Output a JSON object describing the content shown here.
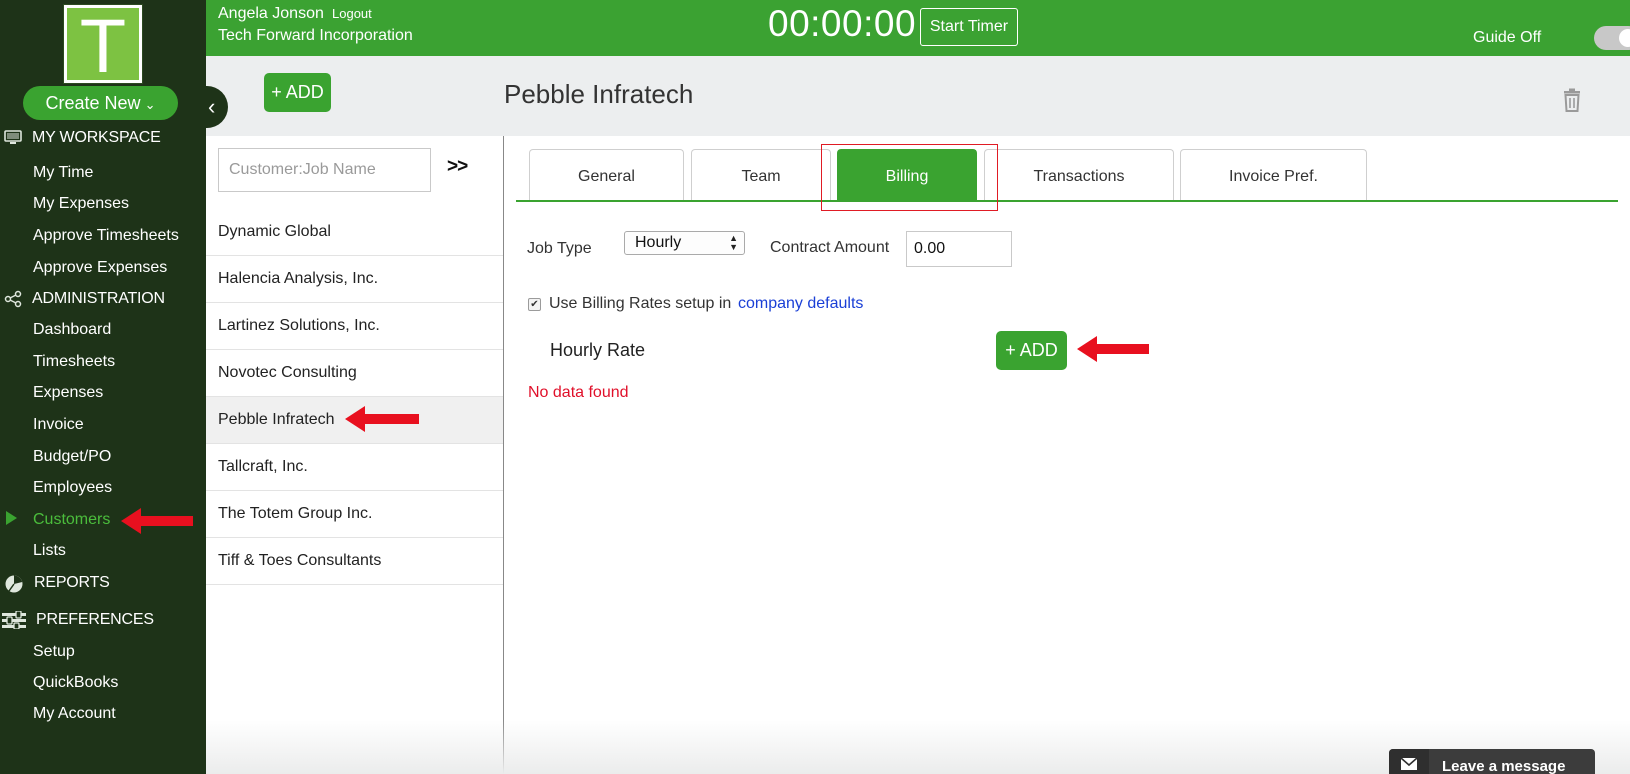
{
  "sidebar": {
    "logo_letter": "T",
    "create_new_label": "Create New",
    "create_new_chevron": "⌄",
    "sections": {
      "workspace": {
        "label": "MY WORKSPACE",
        "icon": "monitor-icon"
      },
      "administration": {
        "label": "ADMINISTRATION",
        "icon": "share-icon"
      },
      "reports": {
        "label": "REPORTS",
        "icon": "pie-chart-icon"
      },
      "preferences": {
        "label": "PREFERENCES",
        "icon": "sliders-icon"
      }
    },
    "workspace_items": [
      "My Time",
      "My Expenses",
      "Approve Timesheets",
      "Approve Expenses"
    ],
    "admin_items": [
      "Dashboard",
      "Timesheets",
      "Expenses",
      "Invoice",
      "Budget/PO",
      "Employees",
      "Customers",
      "Lists"
    ],
    "preference_items": [
      "Setup",
      "QuickBooks",
      "My Account"
    ],
    "active_item": "Customers",
    "active_color": "#4bbd3c"
  },
  "topbar": {
    "user_name": "Angela Jonson",
    "logout_label": "Logout",
    "company": "Tech Forward Incorporation",
    "timer": "00:00:00",
    "start_timer_label": "Start Timer",
    "guide_label": "Guide Off",
    "guide_on": false,
    "brand_color": "#3ba232"
  },
  "header": {
    "add_label": "+ ADD",
    "collapse_glyph": "‹",
    "page_title": "Pebble Infratech",
    "delete_icon": "trash-icon"
  },
  "customers": {
    "search_placeholder": "Customer:Job Name",
    "expand_label": ">>",
    "items": [
      "Dynamic Global",
      "Halencia Analysis, Inc.",
      "Lartinez Solutions, Inc.",
      "Novotec Consulting",
      "Pebble Infratech",
      "Tallcraft, Inc.",
      "The Totem Group Inc.",
      "Tiff & Toes Consultants"
    ],
    "selected": "Pebble Infratech"
  },
  "tabs": {
    "items": [
      "General",
      "Team",
      "Billing",
      "Transactions",
      "Invoice Pref."
    ],
    "active": "Billing"
  },
  "billing": {
    "job_type_label": "Job Type",
    "job_type_value": "Hourly",
    "contract_amount_label": "Contract Amount",
    "contract_amount_value": "0.00",
    "use_billing_text": "Use Billing Rates setup in",
    "use_billing_checked": true,
    "company_defaults_link": "company defaults",
    "hourly_rate_label": "Hourly Rate",
    "add_label": "+ ADD",
    "no_data": "No data found",
    "no_data_color": "#e0102a"
  },
  "annotations": {
    "arrow_color": "#e8101f",
    "highlight_color": "#e01b24"
  },
  "chat": {
    "label": "Leave a message",
    "icon": "envelope-icon"
  }
}
